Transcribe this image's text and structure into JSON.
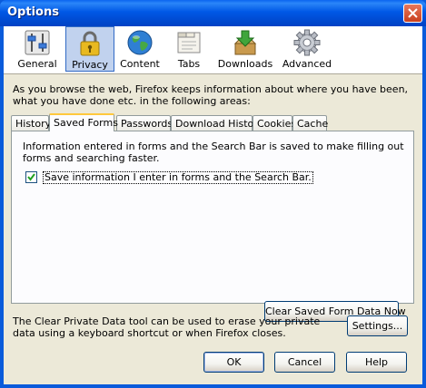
{
  "window": {
    "title": "Options",
    "close_label": "close"
  },
  "toolbar": {
    "items": [
      {
        "label": "General",
        "icon": "general-sliders-icon"
      },
      {
        "label": "Privacy",
        "icon": "padlock-icon",
        "selected": true
      },
      {
        "label": "Content",
        "icon": "globe-icon"
      },
      {
        "label": "Tabs",
        "icon": "tabs-window-icon"
      },
      {
        "label": "Downloads",
        "icon": "download-box-icon"
      },
      {
        "label": "Advanced",
        "icon": "gear-icon"
      }
    ]
  },
  "privacy": {
    "description": "As you browse the web, Firefox keeps information about where you have been, what you have done etc. in the following areas:",
    "tabs": [
      {
        "label": "History"
      },
      {
        "label": "Saved Forms",
        "active": true
      },
      {
        "label": "Passwords"
      },
      {
        "label": "Download History"
      },
      {
        "label": "Cookies"
      },
      {
        "label": "Cache"
      }
    ],
    "saved_forms": {
      "info": "Information entered in forms and the Search Bar is saved to make filling out forms and searching faster.",
      "checkbox_label": "Save information I enter in forms and the Search Bar.",
      "checkbox_checked": true,
      "clear_button": "Clear Saved Form Data Now"
    },
    "footer_text": "The Clear Private Data tool can be used to erase your private data using a keyboard shortcut or when Firefox closes.",
    "settings_button": "Settings..."
  },
  "buttons": {
    "ok": "OK",
    "cancel": "Cancel",
    "help": "Help"
  },
  "colors": {
    "titlebar": "#0058E6",
    "dialog_bg": "#ECE9D8",
    "selected_toolbar": "#C1D2EE",
    "check_mark": "#21A121"
  }
}
